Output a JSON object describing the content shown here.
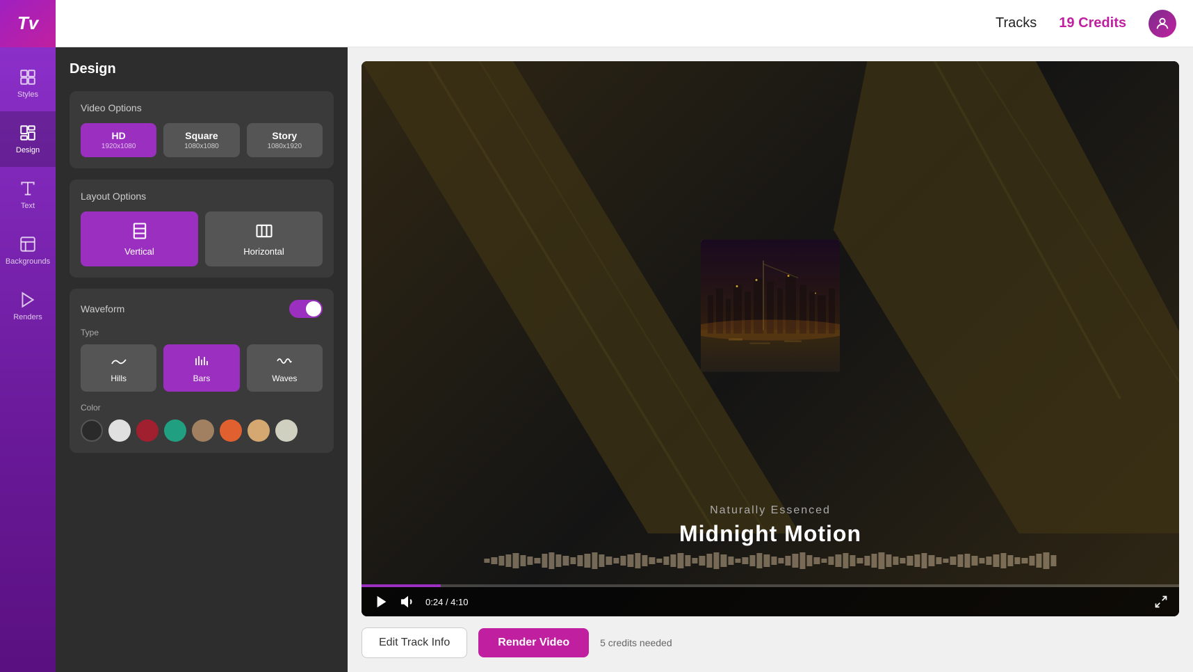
{
  "topbar": {
    "logo": "Tv",
    "tracks_label": "Tracks",
    "credits_label": "19 Credits"
  },
  "sidebar": {
    "items": [
      {
        "id": "styles",
        "label": "Styles",
        "active": false
      },
      {
        "id": "design",
        "label": "Design",
        "active": true
      },
      {
        "id": "text",
        "label": "Text",
        "active": false
      },
      {
        "id": "backgrounds",
        "label": "Backgrounds",
        "active": false
      },
      {
        "id": "renders",
        "label": "Renders",
        "active": false
      }
    ]
  },
  "design_panel": {
    "title": "Design",
    "video_options": {
      "section_title": "Video Options",
      "options": [
        {
          "label": "HD",
          "sub": "1920x1080",
          "active": true
        },
        {
          "label": "Square",
          "sub": "1080x1080",
          "active": false
        },
        {
          "label": "Story",
          "sub": "1080x1920",
          "active": false
        }
      ]
    },
    "layout_options": {
      "section_title": "Layout Options",
      "options": [
        {
          "label": "Vertical",
          "active": true
        },
        {
          "label": "Horizontal",
          "active": false
        }
      ]
    },
    "waveform": {
      "section_title": "Waveform",
      "enabled": true,
      "type_label": "Type",
      "types": [
        {
          "label": "Hills",
          "active": false
        },
        {
          "label": "Bars",
          "active": true
        },
        {
          "label": "Waves",
          "active": false
        }
      ],
      "color_label": "Color",
      "colors": [
        {
          "hex": "#2a2a2a",
          "selected": false
        },
        {
          "hex": "#e0e0e0",
          "selected": false
        },
        {
          "hex": "#a02030",
          "selected": false
        },
        {
          "hex": "#20a080",
          "selected": false
        },
        {
          "hex": "#a08060",
          "selected": false
        },
        {
          "hex": "#e06030",
          "selected": false
        },
        {
          "hex": "#d4a870",
          "selected": false
        },
        {
          "hex": "#d0d0c0",
          "selected": false
        }
      ]
    }
  },
  "video_preview": {
    "artist": "Naturally Essenced",
    "title": "Midnight Motion",
    "time_current": "0:24",
    "time_total": "4:10",
    "progress_percent": 9.7
  },
  "bottom_actions": {
    "edit_track_label": "Edit Track Info",
    "render_label": "Render Video",
    "credits_label": "5 credits needed"
  }
}
